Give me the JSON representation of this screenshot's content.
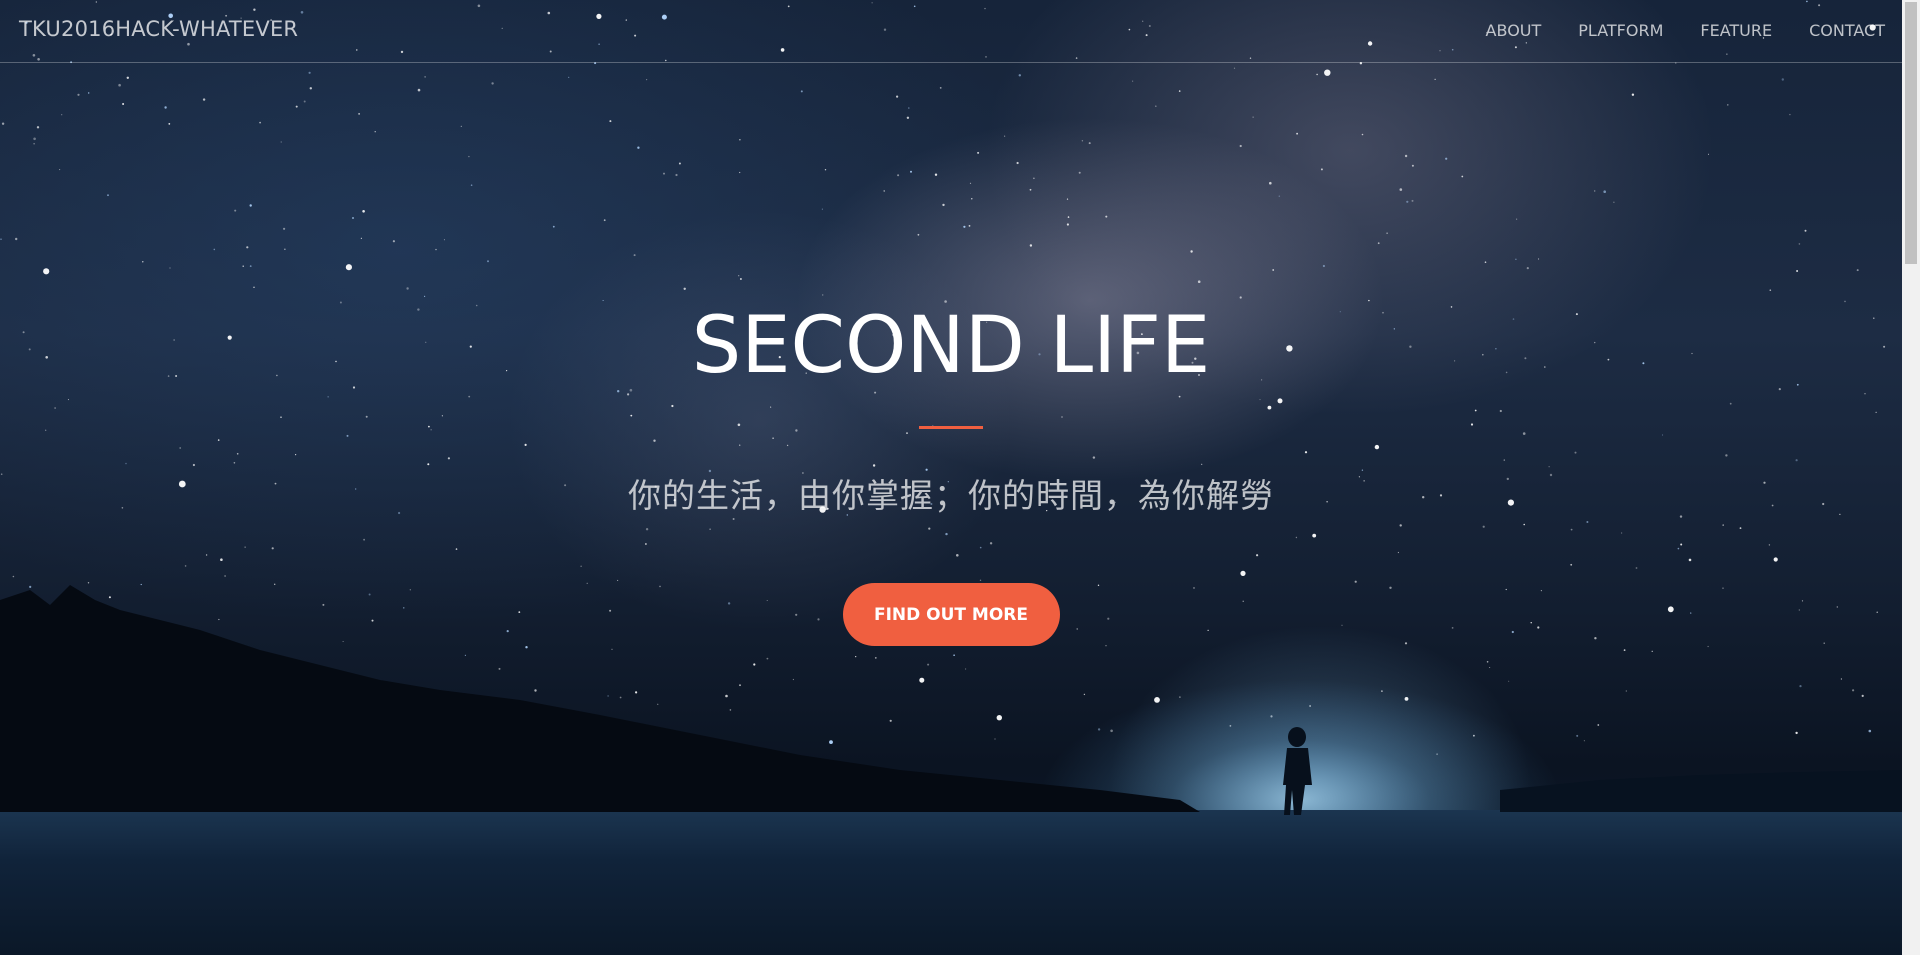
{
  "navbar": {
    "brand": "TKU2016HACK-WHATEVER",
    "links": [
      {
        "label": "ABOUT"
      },
      {
        "label": "PLATFORM"
      },
      {
        "label": "FEATURE"
      },
      {
        "label": "CONTACT"
      }
    ]
  },
  "hero": {
    "title": "SECOND LIFE",
    "subtitle": "你的生活，由你掌握；你的時間，為你解勞",
    "cta_label": "FIND OUT MORE"
  },
  "colors": {
    "accent": "#f05f40"
  }
}
